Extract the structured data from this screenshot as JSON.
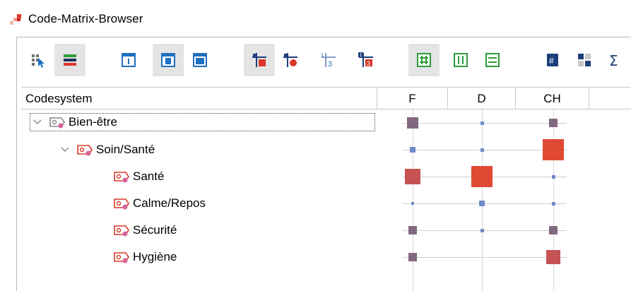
{
  "window": {
    "title": "Code-Matrix-Browser"
  },
  "colors": {
    "small": "#6d8bc6",
    "medium": "#83697f",
    "large": "#c55353",
    "xlarge": "#e04a34",
    "accent_green": "#2e9b3a",
    "accent_blue": "#1f6fc1",
    "navy": "#1d3f7a"
  },
  "toolbar": {
    "buttons": [
      {
        "name": "select-codes-icon",
        "active": false
      },
      {
        "name": "color-rows-icon",
        "active": true
      },
      {
        "name": "layout-left-icon",
        "active": false
      },
      {
        "name": "layout-center-icon",
        "active": true
      },
      {
        "name": "layout-top-icon",
        "active": false
      },
      {
        "name": "symbol-squares-icon",
        "active": true
      },
      {
        "name": "symbol-circles-icon",
        "active": false
      },
      {
        "name": "symbol-numbers-icon",
        "active": false
      },
      {
        "name": "symbol-colored-numbers-icon",
        "active": false
      },
      {
        "name": "grid-all-icon",
        "active": true
      },
      {
        "name": "grid-columns-icon",
        "active": false
      },
      {
        "name": "grid-rows-icon",
        "active": false
      },
      {
        "name": "show-count-icon",
        "active": false
      },
      {
        "name": "show-values-icon",
        "active": false
      },
      {
        "name": "sum-icon",
        "active": false
      }
    ]
  },
  "table": {
    "header_label": "Codesystem",
    "columns": [
      "F",
      "D",
      "CH"
    ],
    "rows": [
      {
        "label": "Bien-être",
        "depth": 0,
        "expanded": true,
        "focused": true,
        "sizes": [
          "medium",
          "tiny",
          "small-medium"
        ]
      },
      {
        "label": "Soin/Santé",
        "depth": 1,
        "expanded": true,
        "focused": false,
        "sizes": [
          "small",
          "tiny",
          "xlarge"
        ]
      },
      {
        "label": "Santé",
        "depth": 2,
        "expanded": null,
        "focused": false,
        "sizes": [
          "large",
          "xlarge",
          "tiny"
        ]
      },
      {
        "label": "Calme/Repos",
        "depth": 2,
        "expanded": null,
        "focused": false,
        "sizes": [
          "dot",
          "small",
          "tiny"
        ]
      },
      {
        "label": "Sécurité",
        "depth": 2,
        "expanded": null,
        "focused": false,
        "sizes": [
          "small-medium",
          "tiny",
          "small-medium"
        ]
      },
      {
        "label": "Hygiène",
        "depth": 2,
        "expanded": null,
        "focused": false,
        "sizes": [
          "small-medium",
          "none",
          "medium-large"
        ]
      }
    ]
  }
}
